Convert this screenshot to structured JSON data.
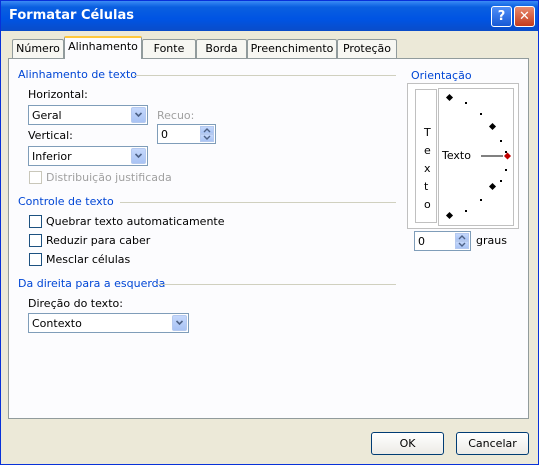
{
  "window": {
    "title": "Formatar Células"
  },
  "tabs": [
    {
      "label": "Número"
    },
    {
      "label": "Alinhamento"
    },
    {
      "label": "Fonte"
    },
    {
      "label": "Borda"
    },
    {
      "label": "Preenchimento"
    },
    {
      "label": "Proteção"
    }
  ],
  "text_alignment": {
    "section_title": "Alinhamento de texto",
    "horizontal_label": "Horizontal:",
    "horizontal_value": "Geral",
    "indent_label": "Recuo:",
    "indent_value": "0",
    "vertical_label": "Vertical:",
    "vertical_value": "Inferior",
    "justify_distributed_label": "Distribuição justificada"
  },
  "text_control": {
    "section_title": "Controle de texto",
    "wrap_text_label": "Quebrar texto automaticamente",
    "shrink_to_fit_label": "Reduzir para caber",
    "merge_cells_label": "Mesclar células"
  },
  "rtl": {
    "section_title": "Da direita para a esquerda",
    "direction_label": "Direção do texto:",
    "direction_value": "Contexto"
  },
  "orientation": {
    "section_title": "Orientação",
    "vertical_chars": [
      "T",
      "e",
      "x",
      "t",
      "o"
    ],
    "dial_text": "Texto",
    "degrees_value": "0",
    "degrees_label": "graus"
  },
  "buttons": {
    "ok": "OK",
    "cancel": "Cancelar"
  },
  "colors": {
    "titlebar": "#0054E3",
    "section_text": "#0046D5",
    "dialog_bg": "#ECE9D8",
    "dial_marker": "#C00000"
  }
}
